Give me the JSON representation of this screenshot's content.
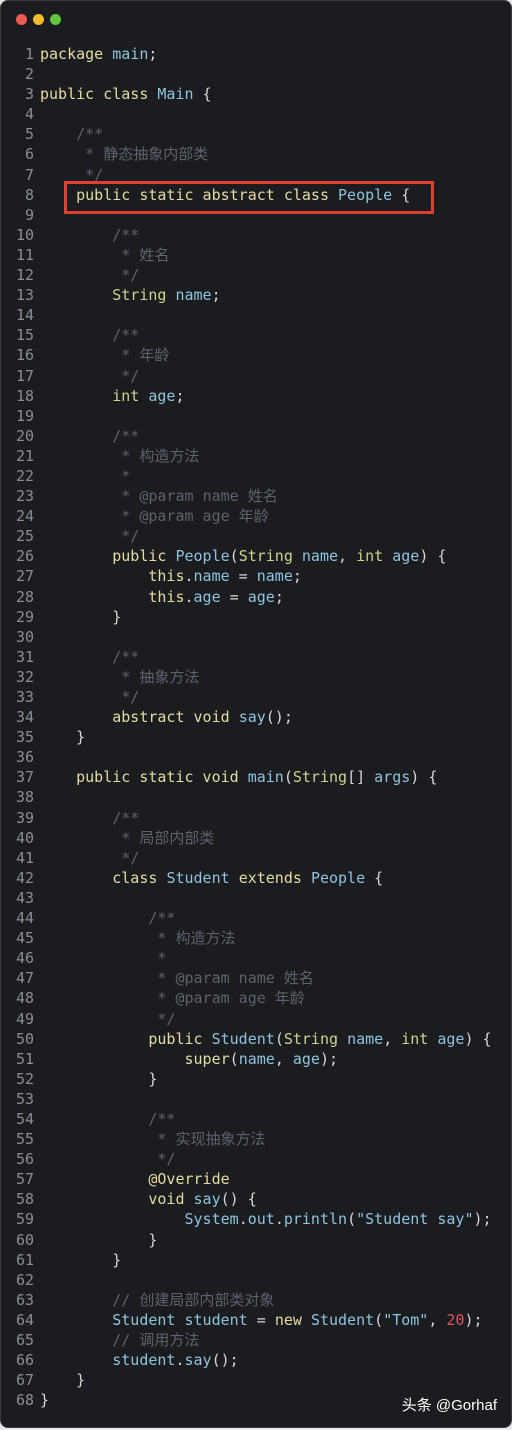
{
  "window": {
    "controls": [
      {
        "name": "close",
        "color": "#ee5a52"
      },
      {
        "name": "minimize",
        "color": "#f4bb2e"
      },
      {
        "name": "maximize",
        "color": "#5fc83f"
      }
    ]
  },
  "highlight": {
    "line": 8,
    "color": "#e0412f"
  },
  "watermark": "头条 @Gorhaf",
  "code": [
    [
      [
        "kw",
        "package"
      ],
      [
        "pl",
        " "
      ],
      [
        "id",
        "main"
      ],
      [
        "pl",
        ";"
      ]
    ],
    [],
    [
      [
        "kw",
        "public class"
      ],
      [
        "pl",
        " "
      ],
      [
        "id",
        "Main"
      ],
      [
        "pl",
        " {"
      ]
    ],
    [],
    [
      [
        "cm",
        "    /**"
      ]
    ],
    [
      [
        "cm",
        "     * 静态抽象内部类"
      ]
    ],
    [
      [
        "cm",
        "     */"
      ]
    ],
    [
      [
        "pl",
        "    "
      ],
      [
        "kw",
        "public static abstract class"
      ],
      [
        "pl",
        " "
      ],
      [
        "id",
        "People"
      ],
      [
        "pl",
        " {"
      ]
    ],
    [],
    [
      [
        "cm",
        "        /**"
      ]
    ],
    [
      [
        "cm",
        "         * 姓名"
      ]
    ],
    [
      [
        "cm",
        "         */"
      ]
    ],
    [
      [
        "pl",
        "        "
      ],
      [
        "ty",
        "String"
      ],
      [
        "pl",
        " "
      ],
      [
        "id",
        "name"
      ],
      [
        "pl",
        ";"
      ]
    ],
    [],
    [
      [
        "cm",
        "        /**"
      ]
    ],
    [
      [
        "cm",
        "         * 年龄"
      ]
    ],
    [
      [
        "cm",
        "         */"
      ]
    ],
    [
      [
        "pl",
        "        "
      ],
      [
        "ty",
        "int"
      ],
      [
        "pl",
        " "
      ],
      [
        "id",
        "age"
      ],
      [
        "pl",
        ";"
      ]
    ],
    [],
    [
      [
        "cm",
        "        /**"
      ]
    ],
    [
      [
        "cm",
        "         * 构造方法"
      ]
    ],
    [
      [
        "cm",
        "         *"
      ]
    ],
    [
      [
        "cm",
        "         * @param name 姓名"
      ]
    ],
    [
      [
        "cm",
        "         * @param age 年龄"
      ]
    ],
    [
      [
        "cm",
        "         */"
      ]
    ],
    [
      [
        "pl",
        "        "
      ],
      [
        "kw",
        "public"
      ],
      [
        "pl",
        " "
      ],
      [
        "id",
        "People"
      ],
      [
        "pl",
        "("
      ],
      [
        "ty",
        "String"
      ],
      [
        "pl",
        " "
      ],
      [
        "id",
        "name"
      ],
      [
        "pl",
        ", "
      ],
      [
        "ty",
        "int"
      ],
      [
        "pl",
        " "
      ],
      [
        "id",
        "age"
      ],
      [
        "pl",
        ") {"
      ]
    ],
    [
      [
        "pl",
        "            "
      ],
      [
        "kw",
        "this"
      ],
      [
        "pl",
        "."
      ],
      [
        "id",
        "name"
      ],
      [
        "pl",
        " = "
      ],
      [
        "id",
        "name"
      ],
      [
        "pl",
        ";"
      ]
    ],
    [
      [
        "pl",
        "            "
      ],
      [
        "kw",
        "this"
      ],
      [
        "pl",
        "."
      ],
      [
        "id",
        "age"
      ],
      [
        "pl",
        " = "
      ],
      [
        "id",
        "age"
      ],
      [
        "pl",
        ";"
      ]
    ],
    [
      [
        "pl",
        "        }"
      ]
    ],
    [],
    [
      [
        "cm",
        "        /**"
      ]
    ],
    [
      [
        "cm",
        "         * 抽象方法"
      ]
    ],
    [
      [
        "cm",
        "         */"
      ]
    ],
    [
      [
        "pl",
        "        "
      ],
      [
        "kw",
        "abstract void"
      ],
      [
        "pl",
        " "
      ],
      [
        "id",
        "say"
      ],
      [
        "pl",
        "();"
      ]
    ],
    [
      [
        "pl",
        "    }"
      ]
    ],
    [],
    [
      [
        "pl",
        "    "
      ],
      [
        "kw",
        "public static void"
      ],
      [
        "pl",
        " "
      ],
      [
        "id",
        "main"
      ],
      [
        "pl",
        "("
      ],
      [
        "ty",
        "String"
      ],
      [
        "pl",
        "[] "
      ],
      [
        "id",
        "args"
      ],
      [
        "pl",
        ") {"
      ]
    ],
    [],
    [
      [
        "cm",
        "        /**"
      ]
    ],
    [
      [
        "cm",
        "         * 局部内部类"
      ]
    ],
    [
      [
        "cm",
        "         */"
      ]
    ],
    [
      [
        "pl",
        "        "
      ],
      [
        "kw",
        "class"
      ],
      [
        "pl",
        " "
      ],
      [
        "id",
        "Student"
      ],
      [
        "pl",
        " "
      ],
      [
        "kw",
        "extends"
      ],
      [
        "pl",
        " "
      ],
      [
        "id",
        "People"
      ],
      [
        "pl",
        " {"
      ]
    ],
    [],
    [
      [
        "cm",
        "            /**"
      ]
    ],
    [
      [
        "cm",
        "             * 构造方法"
      ]
    ],
    [
      [
        "cm",
        "             *"
      ]
    ],
    [
      [
        "cm",
        "             * @param name 姓名"
      ]
    ],
    [
      [
        "cm",
        "             * @param age 年龄"
      ]
    ],
    [
      [
        "cm",
        "             */"
      ]
    ],
    [
      [
        "pl",
        "            "
      ],
      [
        "kw",
        "public"
      ],
      [
        "pl",
        " "
      ],
      [
        "id",
        "Student"
      ],
      [
        "pl",
        "("
      ],
      [
        "ty",
        "String"
      ],
      [
        "pl",
        " "
      ],
      [
        "id",
        "name"
      ],
      [
        "pl",
        ", "
      ],
      [
        "ty",
        "int"
      ],
      [
        "pl",
        " "
      ],
      [
        "id",
        "age"
      ],
      [
        "pl",
        ") {"
      ]
    ],
    [
      [
        "pl",
        "                "
      ],
      [
        "kw",
        "super"
      ],
      [
        "pl",
        "("
      ],
      [
        "id",
        "name"
      ],
      [
        "pl",
        ", "
      ],
      [
        "id",
        "age"
      ],
      [
        "pl",
        ");"
      ]
    ],
    [
      [
        "pl",
        "            }"
      ]
    ],
    [],
    [
      [
        "cm",
        "            /**"
      ]
    ],
    [
      [
        "cm",
        "             * 实现抽象方法"
      ]
    ],
    [
      [
        "cm",
        "             */"
      ]
    ],
    [
      [
        "pl",
        "            "
      ],
      [
        "an",
        "@Override"
      ]
    ],
    [
      [
        "pl",
        "            "
      ],
      [
        "kw",
        "void"
      ],
      [
        "pl",
        " "
      ],
      [
        "id",
        "say"
      ],
      [
        "pl",
        "() {"
      ]
    ],
    [
      [
        "pl",
        "                "
      ],
      [
        "id",
        "System"
      ],
      [
        "pl",
        "."
      ],
      [
        "id",
        "out"
      ],
      [
        "pl",
        "."
      ],
      [
        "id",
        "println"
      ],
      [
        "pl",
        "("
      ],
      [
        "str",
        "\"Student say\""
      ],
      [
        "pl",
        ");"
      ]
    ],
    [
      [
        "pl",
        "            }"
      ]
    ],
    [
      [
        "pl",
        "        }"
      ]
    ],
    [],
    [
      [
        "cm",
        "        // 创建局部内部类对象"
      ]
    ],
    [
      [
        "pl",
        "        "
      ],
      [
        "id",
        "Student"
      ],
      [
        "pl",
        " "
      ],
      [
        "id",
        "student"
      ],
      [
        "pl",
        " = "
      ],
      [
        "kw",
        "new"
      ],
      [
        "pl",
        " "
      ],
      [
        "id",
        "Student"
      ],
      [
        "pl",
        "("
      ],
      [
        "str",
        "\"Tom\""
      ],
      [
        "pl",
        ", "
      ],
      [
        "num",
        "20"
      ],
      [
        "pl",
        ");"
      ]
    ],
    [
      [
        "cm",
        "        // 调用方法"
      ]
    ],
    [
      [
        "pl",
        "        "
      ],
      [
        "id",
        "student"
      ],
      [
        "pl",
        "."
      ],
      [
        "id",
        "say"
      ],
      [
        "pl",
        "();"
      ]
    ],
    [
      [
        "pl",
        "    }"
      ]
    ],
    [
      [
        "pl",
        "}"
      ]
    ]
  ]
}
